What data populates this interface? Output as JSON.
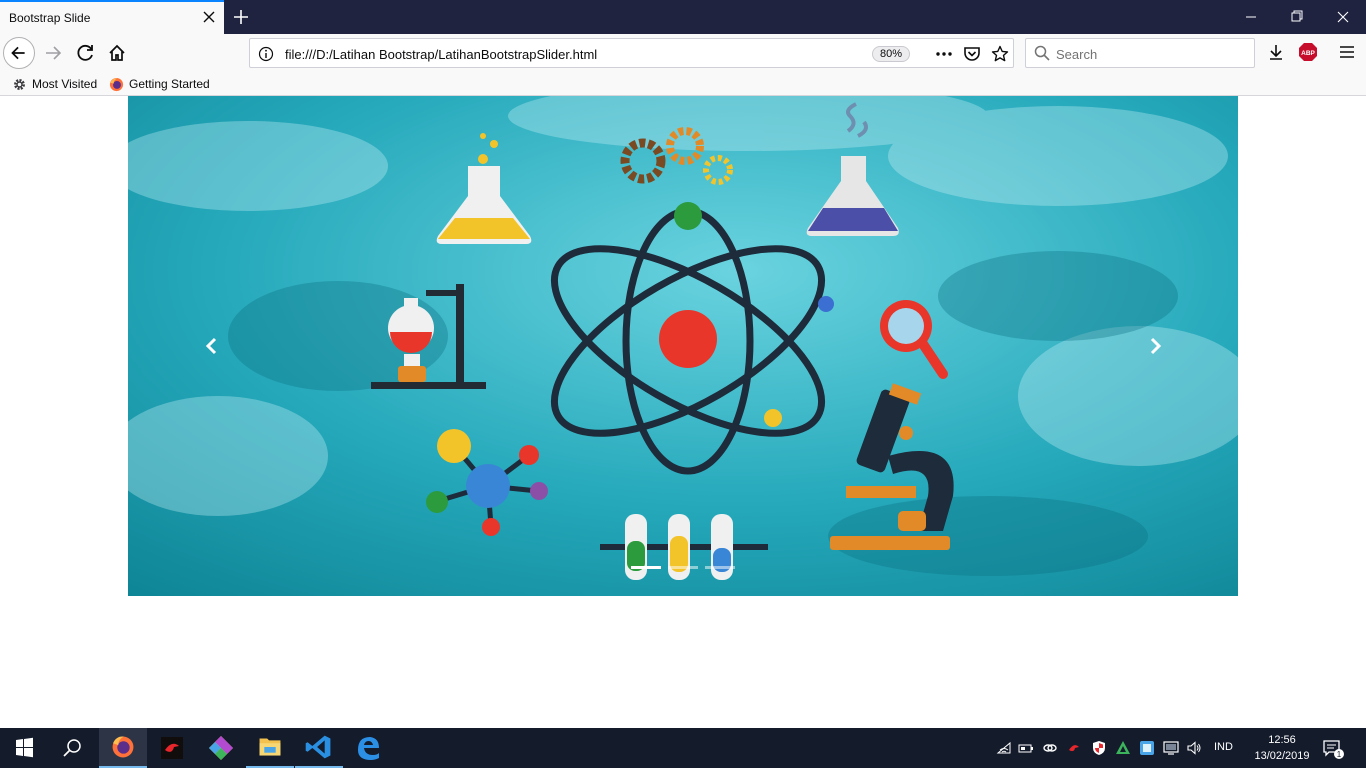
{
  "browser": {
    "tab_title": "Bootstrap Slide",
    "url": "file:///D:/Latihan Bootstrap/LatihanBootstrapSlider.html",
    "zoom": "80%",
    "search_placeholder": "Search",
    "bookmarks": [
      "Most Visited",
      "Getting Started"
    ],
    "abp_label": "ABP"
  },
  "carousel": {
    "slide_count": 3,
    "active_slide": 1,
    "image_subject": "science icons: atom, flasks, microscope, molecule, test tubes"
  },
  "taskbar": {
    "apps": [
      "start",
      "search",
      "firefox",
      "garena",
      "git",
      "file-explorer",
      "vscode",
      "edge"
    ],
    "language": "IND",
    "time": "12:56",
    "date": "13/02/2019",
    "notification_count": "1"
  },
  "colors": {
    "tab_accent": "#0a84ff",
    "titlebar": "#202340",
    "slide_background": "#1fa6b8",
    "taskbar": "#141b2b"
  }
}
